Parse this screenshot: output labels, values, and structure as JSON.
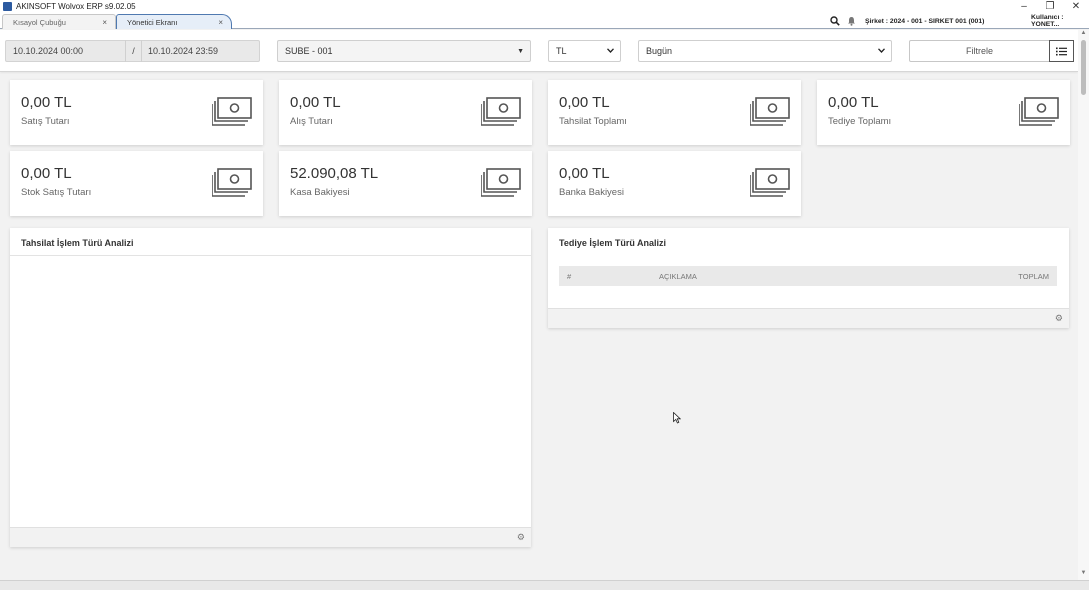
{
  "window": {
    "title": "AKINSOFT Wolvox ERP s9.02.05",
    "controls": [
      "–",
      "❐",
      "✕"
    ]
  },
  "tabs": [
    {
      "label": "Kısayol Çubuğu",
      "close": "×"
    },
    {
      "label": "Yönetici Ekranı",
      "close": "×"
    }
  ],
  "topbar": {
    "company": "Şirket : 2024 - 001 - SIRKET 001 (001)",
    "user": "Kullanıcı : YONET..."
  },
  "filters": {
    "date_start": "10.10.2024 00:00",
    "date_separator": "/",
    "date_end": "10.10.2024 23:59",
    "branch": "SUBE - 001",
    "currency": "TL",
    "period": "Bugün",
    "filter_button": "Filtrele"
  },
  "cards": [
    {
      "value": "0,00 TL",
      "label": "Satış Tutarı"
    },
    {
      "value": "0,00 TL",
      "label": "Alış Tutarı"
    },
    {
      "value": "0,00 TL",
      "label": "Tahsilat Toplamı"
    },
    {
      "value": "0,00 TL",
      "label": "Tediye Toplamı"
    },
    {
      "value": "0,00 TL",
      "label": "Stok Satış Tutarı"
    },
    {
      "value": "52.090,08 TL",
      "label": "Kasa Bakiyesi"
    },
    {
      "value": "0,00 TL",
      "label": "Banka Bakiyesi"
    }
  ],
  "panels": {
    "collection": {
      "title": "Tahsilat İşlem Türü Analizi"
    },
    "payment": {
      "title": "Tediye İşlem Türü Analizi",
      "columns": [
        "#",
        "AÇIKLAMA",
        "TOPLAM"
      ]
    }
  },
  "icons": {
    "search": "search-icon",
    "notification": "bell-icon",
    "card": "money-icon",
    "settings": "gear-icon",
    "menu": "list-icon"
  }
}
